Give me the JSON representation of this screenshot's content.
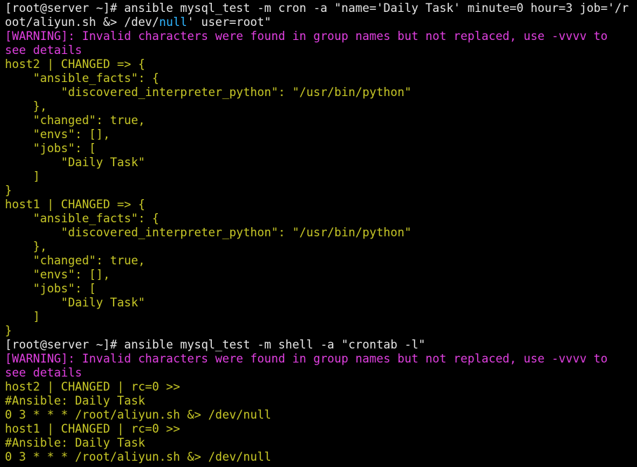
{
  "colors": {
    "background": "#000000",
    "text": "#e6e6e6",
    "success_yellow": "#c8c827",
    "warning_magenta": "#e040e0",
    "null_blue": "#2fb5ff"
  },
  "lines": [
    {
      "segs": [
        {
          "c": "w",
          "t": "[root@server ~]# ansible mysql_test -m cron -a \"name='Daily Task' minute=0 hour=3 job='/r"
        }
      ]
    },
    {
      "segs": [
        {
          "c": "w",
          "t": "oot/aliyun.sh &> /dev/"
        },
        {
          "c": "n",
          "t": "null"
        },
        {
          "c": "w",
          "t": "' user=root\""
        }
      ]
    },
    {
      "segs": [
        {
          "c": "m",
          "t": "[WARNING]: Invalid characters were found in group names but not replaced, use -vvvv to"
        }
      ]
    },
    {
      "segs": [
        {
          "c": "m",
          "t": "see details"
        }
      ]
    },
    {
      "segs": [
        {
          "c": "y",
          "t": "host2 | CHANGED => {"
        }
      ]
    },
    {
      "segs": [
        {
          "c": "y",
          "t": "    \"ansible_facts\": {"
        }
      ]
    },
    {
      "segs": [
        {
          "c": "y",
          "t": "        \"discovered_interpreter_python\": \"/usr/bin/python\""
        }
      ]
    },
    {
      "segs": [
        {
          "c": "y",
          "t": "    },"
        }
      ]
    },
    {
      "segs": [
        {
          "c": "y",
          "t": "    \"changed\": true,"
        }
      ]
    },
    {
      "segs": [
        {
          "c": "y",
          "t": "    \"envs\": [],"
        }
      ]
    },
    {
      "segs": [
        {
          "c": "y",
          "t": "    \"jobs\": ["
        }
      ]
    },
    {
      "segs": [
        {
          "c": "y",
          "t": "        \"Daily Task\""
        }
      ]
    },
    {
      "segs": [
        {
          "c": "y",
          "t": "    ]"
        }
      ]
    },
    {
      "segs": [
        {
          "c": "y",
          "t": "}"
        }
      ]
    },
    {
      "segs": [
        {
          "c": "y",
          "t": "host1 | CHANGED => {"
        }
      ]
    },
    {
      "segs": [
        {
          "c": "y",
          "t": "    \"ansible_facts\": {"
        }
      ]
    },
    {
      "segs": [
        {
          "c": "y",
          "t": "        \"discovered_interpreter_python\": \"/usr/bin/python\""
        }
      ]
    },
    {
      "segs": [
        {
          "c": "y",
          "t": "    },"
        }
      ]
    },
    {
      "segs": [
        {
          "c": "y",
          "t": "    \"changed\": true,"
        }
      ]
    },
    {
      "segs": [
        {
          "c": "y",
          "t": "    \"envs\": [],"
        }
      ]
    },
    {
      "segs": [
        {
          "c": "y",
          "t": "    \"jobs\": ["
        }
      ]
    },
    {
      "segs": [
        {
          "c": "y",
          "t": "        \"Daily Task\""
        }
      ]
    },
    {
      "segs": [
        {
          "c": "y",
          "t": "    ]"
        }
      ]
    },
    {
      "segs": [
        {
          "c": "y",
          "t": "}"
        }
      ]
    },
    {
      "segs": [
        {
          "c": "w",
          "t": "[root@server ~]# ansible mysql_test -m shell -a \"crontab -l\""
        }
      ]
    },
    {
      "segs": [
        {
          "c": "m",
          "t": "[WARNING]: Invalid characters were found in group names but not replaced, use -vvvv to"
        }
      ]
    },
    {
      "segs": [
        {
          "c": "m",
          "t": "see details"
        }
      ]
    },
    {
      "segs": [
        {
          "c": "y",
          "t": "host2 | CHANGED | rc=0 >>"
        }
      ]
    },
    {
      "segs": [
        {
          "c": "y",
          "t": "#Ansible: Daily Task"
        }
      ]
    },
    {
      "segs": [
        {
          "c": "y",
          "t": "0 3 * * * /root/aliyun.sh &> /dev/null"
        }
      ]
    },
    {
      "segs": [
        {
          "c": "y",
          "t": "host1 | CHANGED | rc=0 >>"
        }
      ]
    },
    {
      "segs": [
        {
          "c": "y",
          "t": "#Ansible: Daily Task"
        }
      ]
    },
    {
      "segs": [
        {
          "c": "y",
          "t": "0 3 * * * /root/aliyun.sh &> /dev/null"
        }
      ]
    }
  ]
}
